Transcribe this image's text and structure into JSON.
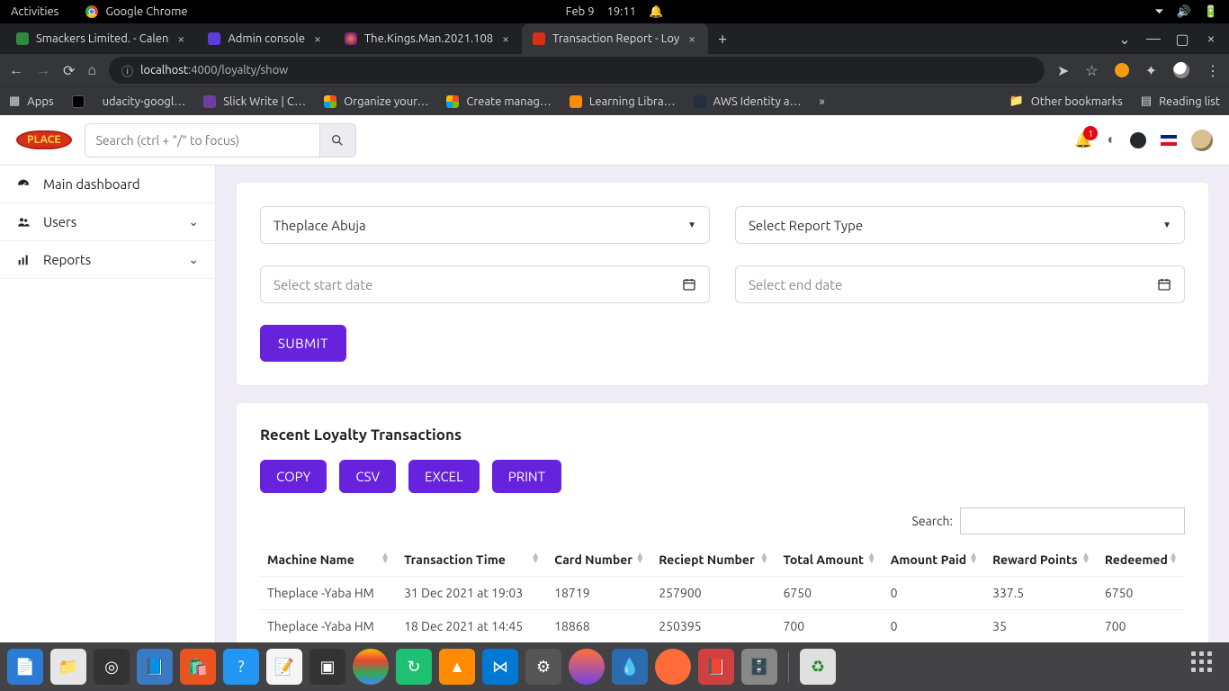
{
  "ubuntu": {
    "activities": "Activities",
    "app": "Google Chrome",
    "date": "Feb 9",
    "time": "19:11"
  },
  "browser": {
    "tabs": [
      {
        "label": "Smackers Limited. - Calen"
      },
      {
        "label": "Admin console"
      },
      {
        "label": "The.Kings.Man.2021.108"
      },
      {
        "label": "Transaction Report - Loy"
      }
    ],
    "url_host": "localhost",
    "url_path": ":4000/loyalty/show"
  },
  "bookmarks": {
    "apps": "Apps",
    "items": [
      "udacity-googl…",
      "Slick Write | C…",
      "Organize your…",
      "Create manag…",
      "Learning Libra…",
      "AWS Identity a…"
    ],
    "more": "»",
    "other": "Other bookmarks",
    "reading": "Reading list"
  },
  "app": {
    "search_placeholder": "Search (ctrl + \"/\" to focus)",
    "badge": "1"
  },
  "sidebar": {
    "items": [
      {
        "label": "Main dashboard",
        "expandable": false
      },
      {
        "label": "Users",
        "expandable": true
      },
      {
        "label": "Reports",
        "expandable": true
      }
    ]
  },
  "filters": {
    "location": "Theplace Abuja",
    "report_type": "Select Report Type",
    "start_placeholder": "Select start date",
    "end_placeholder": "Select end date",
    "submit": "SUBMIT"
  },
  "report": {
    "title": "Recent Loyalty Transactions",
    "buttons": [
      "COPY",
      "CSV",
      "EXCEL",
      "PRINT"
    ],
    "search_label": "Search:",
    "columns": [
      "Machine Name",
      "Transaction Time",
      "Card Number",
      "Reciept Number",
      "Total Amount",
      "Amount Paid",
      "Reward Points",
      "Redeemed"
    ],
    "rows": [
      [
        "Theplace -Yaba HM",
        "31 Dec 2021 at 19:03",
        "18719",
        "257900",
        "6750",
        "0",
        "337.5",
        "6750"
      ],
      [
        "Theplace -Yaba HM",
        "18 Dec 2021 at 14:45",
        "18868",
        "250395",
        "700",
        "0",
        "35",
        "700"
      ]
    ]
  }
}
